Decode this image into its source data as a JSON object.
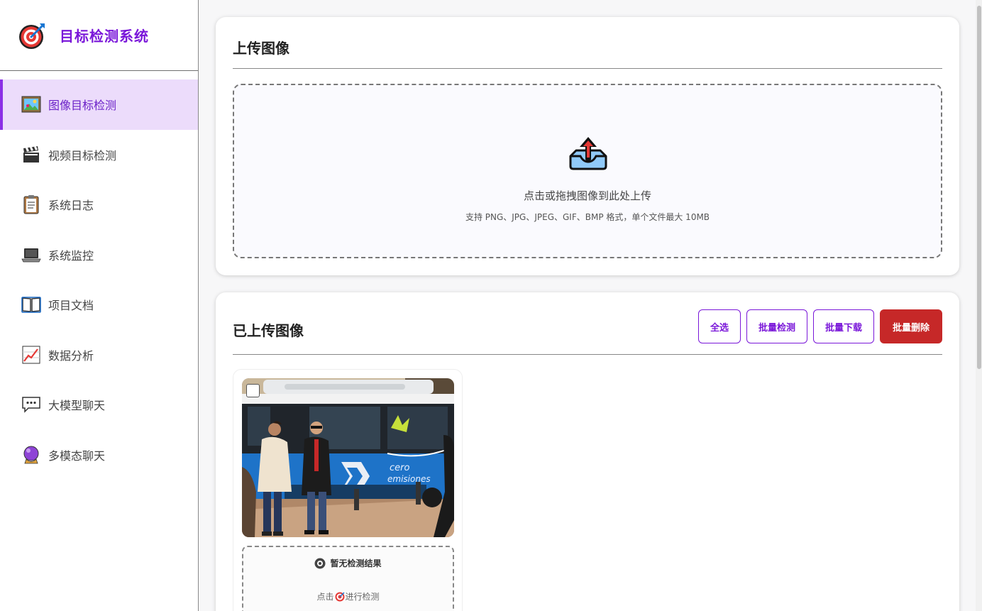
{
  "app": {
    "title": "目标检测系统",
    "logo_icon": "target-icon"
  },
  "sidebar": {
    "items": [
      {
        "label": "图像目标检测",
        "icon": "image-icon",
        "active": true
      },
      {
        "label": "视频目标检测",
        "icon": "clapperboard-icon",
        "active": false
      },
      {
        "label": "系统日志",
        "icon": "clipboard-icon",
        "active": false
      },
      {
        "label": "系统监控",
        "icon": "laptop-icon",
        "active": false
      },
      {
        "label": "项目文档",
        "icon": "book-icon",
        "active": false
      },
      {
        "label": "数据分析",
        "icon": "chart-icon",
        "active": false
      },
      {
        "label": "大模型聊天",
        "icon": "speech-bubble-icon",
        "active": false
      },
      {
        "label": "多模态聊天",
        "icon": "crystal-ball-icon",
        "active": false
      }
    ]
  },
  "upload": {
    "title": "上传图像",
    "dropzone_text": "点击或拖拽图像到此处上传",
    "dropzone_hint": "支持 PNG、JPG、JPEG、GIF、BMP 格式，单个文件最大 10MB"
  },
  "uploaded": {
    "title": "已上传图像",
    "buttons": {
      "select_all": "全选",
      "batch_detect": "批量检测",
      "batch_download": "批量下载",
      "batch_delete": "批量删除"
    },
    "images": [
      {
        "no_result": "暂无检测结果",
        "hint_before": "点击",
        "hint_after": "进行检测"
      }
    ]
  },
  "colors": {
    "accent": "#7a17d9",
    "active_bg": "#ecdcfb",
    "danger": "#c62828"
  }
}
